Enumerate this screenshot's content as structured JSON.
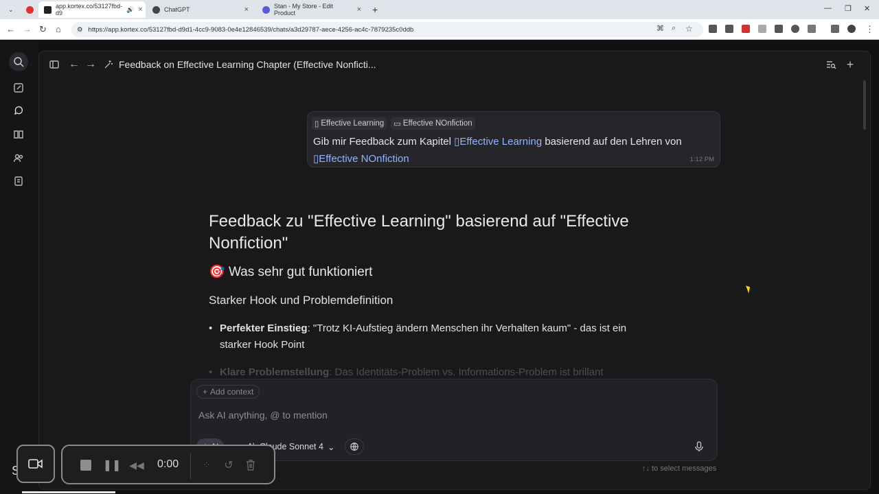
{
  "browser": {
    "tabs": [
      {
        "title": "app.kortex.co/53127fbd-d9",
        "active": true
      },
      {
        "title": "ChatGPT",
        "active": false
      },
      {
        "title": "Stan - My Store - Edit Product",
        "active": false
      }
    ],
    "url": "https://app.kortex.co/53127fbd-d9d1-4cc9-9083-0e4e12846539/chats/a3d29787-aece-4256-ac4c-7879235c0ddb"
  },
  "chat": {
    "title": "Feedback on Effective Learning Chapter (Effective Nonficti..."
  },
  "user_message": {
    "chips": [
      "Effective Learning",
      "Effective NOnfiction"
    ],
    "text_before": "Gib mir Feedback zum Kapitel",
    "ref1": "Effective Learning",
    "text_middle": "basierend auf den Lehren von",
    "ref2": "Effective NOnfiction",
    "time": "1:12 PM"
  },
  "answer": {
    "h1": "Feedback zu \"Effective Learning\" basierend auf \"Effective Nonfiction\"",
    "h2_emoji": "🎯",
    "h2": "Was sehr gut funktioniert",
    "h3": "Starker Hook und Problemdefinition",
    "bullets": [
      {
        "bold": "Perfekter Einstieg",
        "text": ": \"Trotz KI-Aufstieg ändern Menschen ihr Verhalten kaum\" - das ist ein starker Hook Point"
      },
      {
        "bold": "Klare Problemstellung",
        "text": ": Das Identitäts-Problem vs. Informations-Problem ist brillant"
      }
    ]
  },
  "composer": {
    "add_context": "Add context",
    "placeholder": "Ask AI anything, @ to mention",
    "ai_label": "AI",
    "model": "Claude Sonnet 4",
    "hint": "↑↓ to select messages"
  },
  "recorder": {
    "time": "0:00"
  },
  "colors": {
    "background": "#111113",
    "panel": "#19191b",
    "accent_link": "#93b4ff"
  }
}
